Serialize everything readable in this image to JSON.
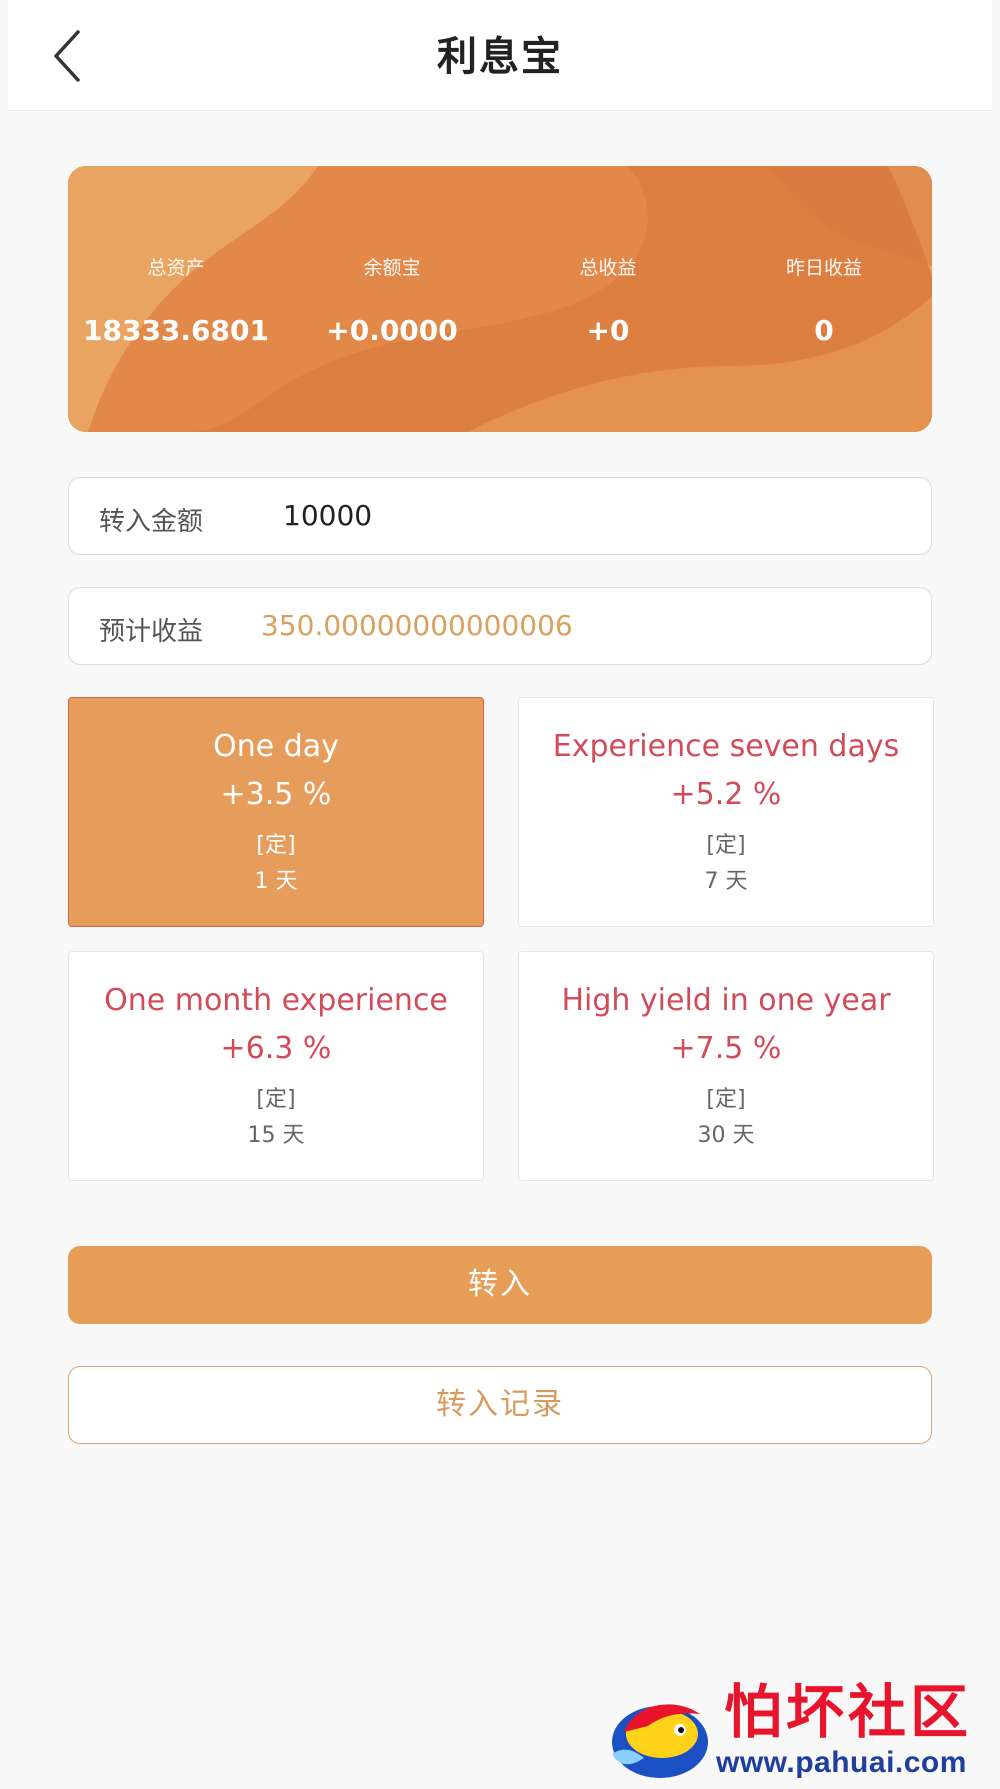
{
  "header": {
    "title": "利息宝",
    "back_icon": "chevron-left-icon"
  },
  "asset_card": {
    "stats": [
      {
        "label": "总资产",
        "value": "18333.6801"
      },
      {
        "label": "余额宝",
        "value": "+0.0000"
      },
      {
        "label": "总收益",
        "value": "+0"
      },
      {
        "label": "昨日收益",
        "value": "0"
      }
    ],
    "colors": {
      "base": "#dc7f41",
      "light": "#e9a461"
    }
  },
  "form": {
    "transfer_amount": {
      "label": "转入金额",
      "value": "10000"
    },
    "expected_earnings": {
      "label": "预计收益",
      "value": "350.00000000000006"
    }
  },
  "plans": [
    {
      "name": "One day",
      "rate": "+3.5 %",
      "type": "[定]",
      "term": "1 天",
      "selected": true
    },
    {
      "name": "Experience seven days",
      "rate": "+5.2 %",
      "type": "[定]",
      "term": "7 天",
      "selected": false
    },
    {
      "name": "One month experience",
      "rate": "+6.3 %",
      "type": "[定]",
      "term": "15 天",
      "selected": false
    },
    {
      "name": "High yield in one year",
      "rate": "+7.5 %",
      "type": "[定]",
      "term": "30 天",
      "selected": false
    }
  ],
  "actions": {
    "transfer_in": "转入",
    "transfer_records": "转入记录"
  },
  "watermark": {
    "text": "怕坏社区",
    "url": "www.pahuai.com"
  },
  "colors": {
    "accent": "#e69d56",
    "plan_text": "#d24b58",
    "earnings_text": "#d9a15f"
  }
}
